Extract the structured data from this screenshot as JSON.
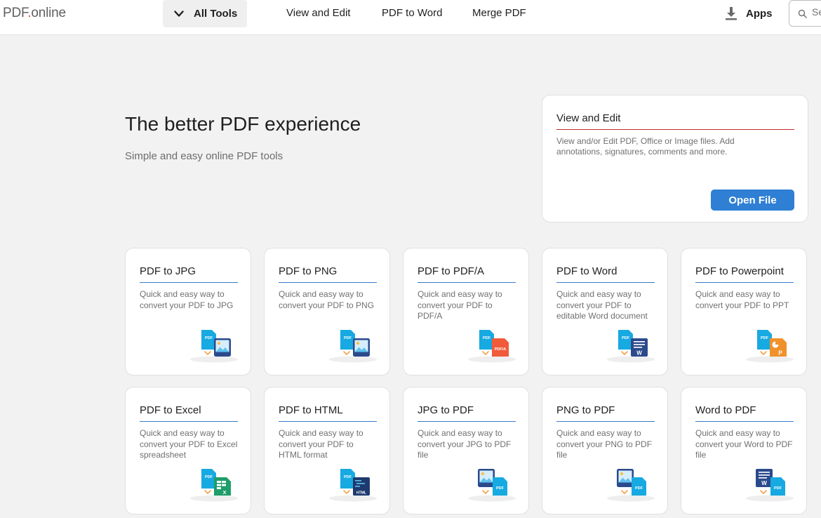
{
  "header": {
    "logo_prefix": "PDF",
    "logo_dot": ".",
    "logo_suffix": "online",
    "all_tools_label": "All Tools",
    "nav": [
      "View and Edit",
      "PDF to Word",
      "Merge PDF"
    ],
    "apps_label": "Apps",
    "search_placeholder": "Search"
  },
  "hero": {
    "title": "The better PDF experience",
    "subtitle": "Simple and easy online PDF tools"
  },
  "view_card": {
    "title": "View and Edit",
    "description": "View and/or Edit PDF, Office or Image files. Add annotations, signatures, comments and more.",
    "button_label": "Open File"
  },
  "tools": [
    {
      "title": "PDF to JPG",
      "description": "Quick and easy way to convert your PDF to JPG",
      "icon": "pdf-to-image-icon"
    },
    {
      "title": "PDF to PNG",
      "description": "Quick and easy way to convert your PDF to PNG",
      "icon": "pdf-to-image-icon"
    },
    {
      "title": "PDF to PDF/A",
      "description": "Quick and easy way to convert your PDF to PDF/A",
      "icon": "pdf-to-pdfa-icon",
      "badge": "PDF/A"
    },
    {
      "title": "PDF to Word",
      "description": "Quick and easy way to convert your PDF to editable Word document",
      "icon": "pdf-to-word-icon",
      "badge": "W"
    },
    {
      "title": "PDF to Powerpoint",
      "description": "Quick and easy way to convert your PDF to PPT",
      "icon": "pdf-to-ppt-icon",
      "badge": "P"
    },
    {
      "title": "PDF to Excel",
      "description": "Quick and easy way to convert your PDF to Excel spreadsheet",
      "icon": "pdf-to-excel-icon",
      "badge": "X"
    },
    {
      "title": "PDF to HTML",
      "description": "Quick and easy way to convert your PDF to HTML format",
      "icon": "pdf-to-html-icon",
      "badge": "HTML"
    },
    {
      "title": "JPG to PDF",
      "description": "Quick and easy way to convert your JPG to PDF file",
      "icon": "image-to-pdf-icon"
    },
    {
      "title": "PNG to PDF",
      "description": "Quick and easy way to convert your PNG to PDF file",
      "icon": "image-to-pdf-icon"
    },
    {
      "title": "Word to PDF",
      "description": "Quick and easy way to convert your Word to PDF file",
      "icon": "word-to-pdf-icon",
      "badge": "W"
    }
  ],
  "icon_label_pdf": "PDF",
  "colors": {
    "primary_blue": "#2f7fd4",
    "accent_red": "#c2272d",
    "pdf_cyan": "#17a9e1",
    "word_navy": "#2b4a8c",
    "pdfa_orange": "#f15a3a",
    "ppt_orange": "#f0922b",
    "excel_green": "#1f9d6a"
  }
}
